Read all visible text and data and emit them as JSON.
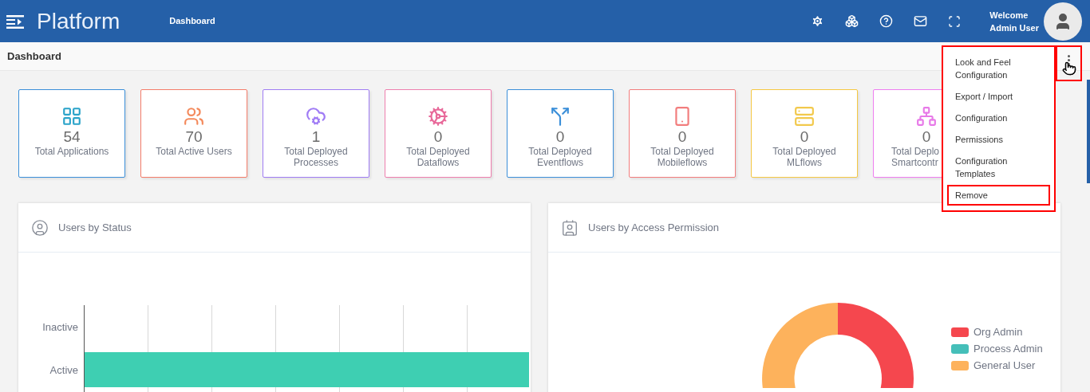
{
  "header": {
    "brand": "Platform",
    "breadcrumb": "Dashboard",
    "welcome": "Welcome",
    "user": "Admin User"
  },
  "page_title": "Dashboard",
  "stats": [
    {
      "value": "54",
      "label_lines": [
        "Total Applications"
      ]
    },
    {
      "value": "70",
      "label_lines": [
        "Total Active Users"
      ]
    },
    {
      "value": "1",
      "label_lines": [
        "Total Deployed",
        "Processes"
      ]
    },
    {
      "value": "0",
      "label_lines": [
        "Total Deployed",
        "Dataflows"
      ]
    },
    {
      "value": "0",
      "label_lines": [
        "Total Deployed",
        "Eventflows"
      ]
    },
    {
      "value": "0",
      "label_lines": [
        "Total Deployed",
        "Mobileflows"
      ]
    },
    {
      "value": "0",
      "label_lines": [
        "Total Deployed",
        "MLflows"
      ]
    },
    {
      "value": "0",
      "label_lines": [
        "Total Deplo",
        "Smartcontr"
      ]
    }
  ],
  "menu": {
    "items": [
      {
        "label_lines": [
          "Look and Feel",
          "Configuration"
        ],
        "highlighted": false
      },
      {
        "label_lines": [
          "Export / Import"
        ],
        "highlighted": false
      },
      {
        "label_lines": [
          "Configuration"
        ],
        "highlighted": false
      },
      {
        "label_lines": [
          "Permissions"
        ],
        "highlighted": false
      },
      {
        "label_lines": [
          "Configuration",
          "Templates"
        ],
        "highlighted": false
      },
      {
        "label_lines": [
          "Remove"
        ],
        "highlighted": true
      }
    ]
  },
  "panels": [
    {
      "kind": "bar",
      "title": "Users by Status",
      "categories": [
        "Inactive",
        "Active"
      ]
    },
    {
      "kind": "donut",
      "title": "Users by Access Permission",
      "legend": [
        {
          "label": "Org Admin",
          "color": "#f5474e"
        },
        {
          "label": "Process Admin",
          "color": "#45bfb9"
        },
        {
          "label": "General User",
          "color": "#fdb25c"
        }
      ]
    }
  ]
}
